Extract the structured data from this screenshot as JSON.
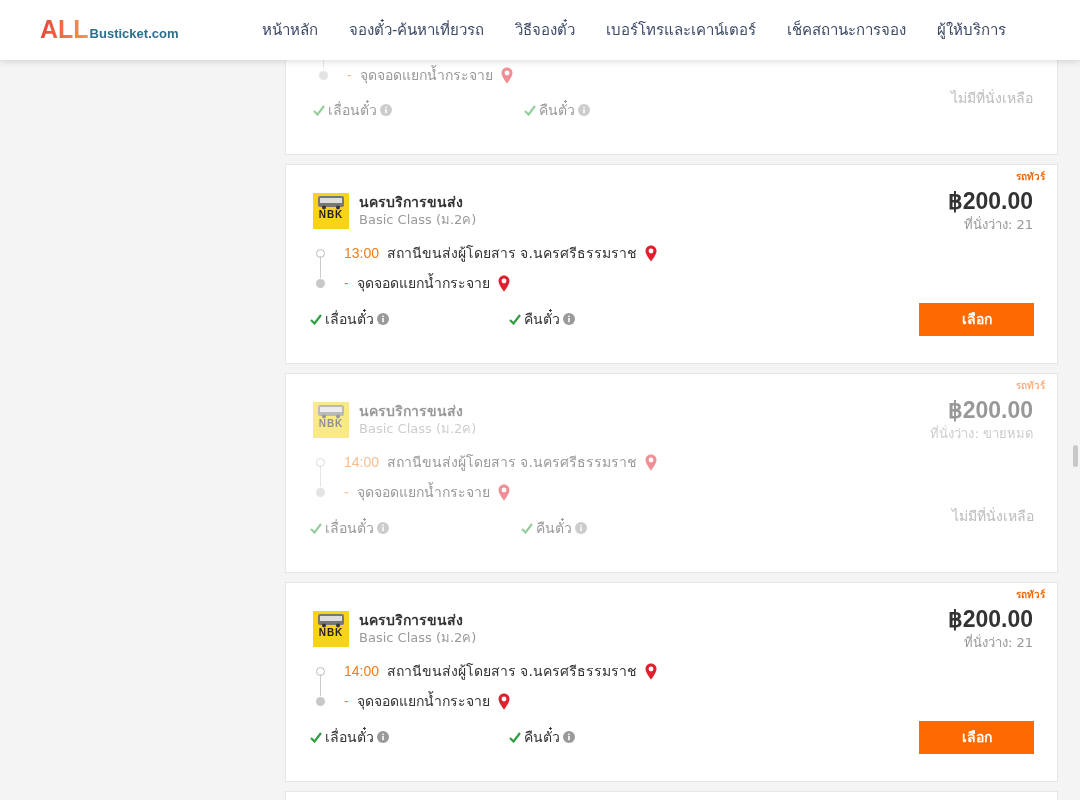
{
  "header": {
    "logo": {
      "brand": "ALL",
      "domain": "Busticket.com"
    },
    "nav": [
      {
        "label": "หน้าหลัก"
      },
      {
        "label": "จองตั๋ว-ค้นหาเที่ยวรถ"
      },
      {
        "label": "วิธีจองตั๋ว"
      },
      {
        "label": "เบอร์โทรและเคาน์เตอร์"
      },
      {
        "label": "เช็คสถานะการจอง"
      },
      {
        "label": "ผู้ให้บริการ"
      }
    ]
  },
  "trips": [
    {
      "kind": "partial",
      "sold_out": true,
      "destination": "จุดจอดแยกน้ำกระจาย",
      "dest_dash": "-",
      "features": [
        "เลื่อนตั๋ว",
        "คืนตั๋ว"
      ],
      "unavailable_text": "ไม่มีที่นั่งเหลือ"
    },
    {
      "kind": "full",
      "sold_out": false,
      "tag": "รถทัวร์",
      "logo_text": "NBK",
      "operator": "นครบริการขนส่ง",
      "bus_class": "Basic Class (ม.2ค)",
      "time": "13:00",
      "origin": "สถานีขนส่งผู้โดยสาร จ.นครศรีธรรมราช",
      "dest_dash": "-",
      "destination": "จุดจอดแยกน้ำกระจาย",
      "features": [
        "เลื่อนตั๋ว",
        "คืนตั๋ว"
      ],
      "price": "฿200.00",
      "seats": "ที่นั่งว่าง: 21",
      "button": "เลือก"
    },
    {
      "kind": "full",
      "sold_out": true,
      "tag": "รถทัวร์",
      "logo_text": "NBK",
      "operator": "นครบริการขนส่ง",
      "bus_class": "Basic Class (ม.2ค)",
      "time": "14:00",
      "origin": "สถานีขนส่งผู้โดยสาร จ.นครศรีธรรมราช",
      "dest_dash": "-",
      "destination": "จุดจอดแยกน้ำกระจาย",
      "features": [
        "เลื่อนตั๋ว",
        "คืนตั๋ว"
      ],
      "price": "฿200.00",
      "seats": "ที่นั่งว่าง: ขายหมด",
      "unavailable_text": "ไม่มีที่นั่งเหลือ"
    },
    {
      "kind": "full",
      "sold_out": false,
      "tag": "รถทัวร์",
      "logo_text": "NBK",
      "operator": "นครบริการขนส่ง",
      "bus_class": "Basic Class (ม.2ค)",
      "time": "14:00",
      "origin": "สถานีขนส่งผู้โดยสาร จ.นครศรีธรรมราช",
      "dest_dash": "-",
      "destination": "จุดจอดแยกน้ำกระจาย",
      "features": [
        "เลื่อนตั๋ว",
        "คืนตั๋ว"
      ],
      "price": "฿200.00",
      "seats": "ที่นั่งว่าง: 21",
      "button": "เลือก"
    },
    {
      "kind": "stub"
    }
  ]
}
